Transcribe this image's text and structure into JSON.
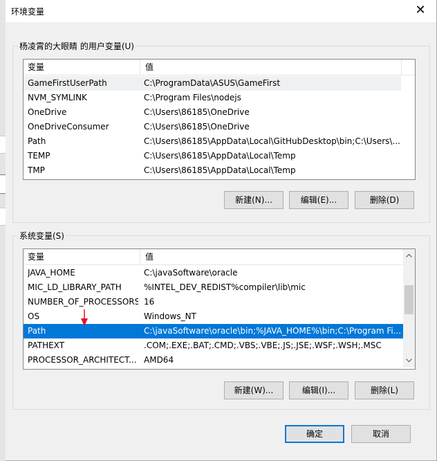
{
  "dialog": {
    "title": "环境变量",
    "close_glyph": "✕"
  },
  "user_vars": {
    "group_label": "杨凌霄的大眼睛 的用户变量(U)",
    "columns": [
      "变量",
      "值"
    ],
    "rows": [
      [
        "GameFirstUserPath",
        "C:\\ProgramData\\ASUS\\GameFirst"
      ],
      [
        "NVM_SYMLINK",
        "C:\\Program Files\\nodejs"
      ],
      [
        "OneDrive",
        "C:\\Users\\86185\\OneDrive"
      ],
      [
        "OneDriveConsumer",
        "C:\\Users\\86185\\OneDrive"
      ],
      [
        "Path",
        "C:\\Users\\86185\\AppData\\Local\\GitHubDesktop\\bin;C:\\Users\\..."
      ],
      [
        "TEMP",
        "C:\\Users\\86185\\AppData\\Local\\Temp"
      ],
      [
        "TMP",
        "C:\\Users\\86185\\AppData\\Local\\Temp"
      ]
    ],
    "buttons": {
      "new": "新建(N)...",
      "edit": "编辑(E)...",
      "delete": "删除(D)"
    }
  },
  "system_vars": {
    "group_label": "系统变量(S)",
    "columns": [
      "变量",
      "值"
    ],
    "rows": [
      [
        "JAVA_HOME",
        "C:\\javaSoftware\\oracle"
      ],
      [
        "MIC_LD_LIBRARY_PATH",
        "%INTEL_DEV_REDIST%compiler\\lib\\mic"
      ],
      [
        "NUMBER_OF_PROCESSORS",
        "16"
      ],
      [
        "OS",
        "Windows_NT"
      ],
      [
        "Path",
        "C:\\javaSoftware\\oracle\\bin;%JAVA_HOME%\\bin;C:\\Program Fi..."
      ],
      [
        "PATHEXT",
        ".COM;.EXE;.BAT;.CMD;.VBS;.VBE;.JS;.JSE;.WSF;.WSH;.MSC"
      ],
      [
        "PROCESSOR_ARCHITECT...",
        "AMD64"
      ]
    ],
    "selected_row": "Path",
    "buttons": {
      "new": "新建(W)...",
      "edit": "编辑(I)...",
      "delete": "删除(L)"
    }
  },
  "footer": {
    "ok": "确定",
    "cancel": "取消"
  },
  "colors": {
    "selection": "#0078d7",
    "annotation_arrow": "#e81123"
  },
  "icons": {
    "close": "close-icon",
    "scroll_up": "chevron-up-icon",
    "scroll_down": "chevron-down-icon",
    "annotation": "red-arrow-icon"
  }
}
